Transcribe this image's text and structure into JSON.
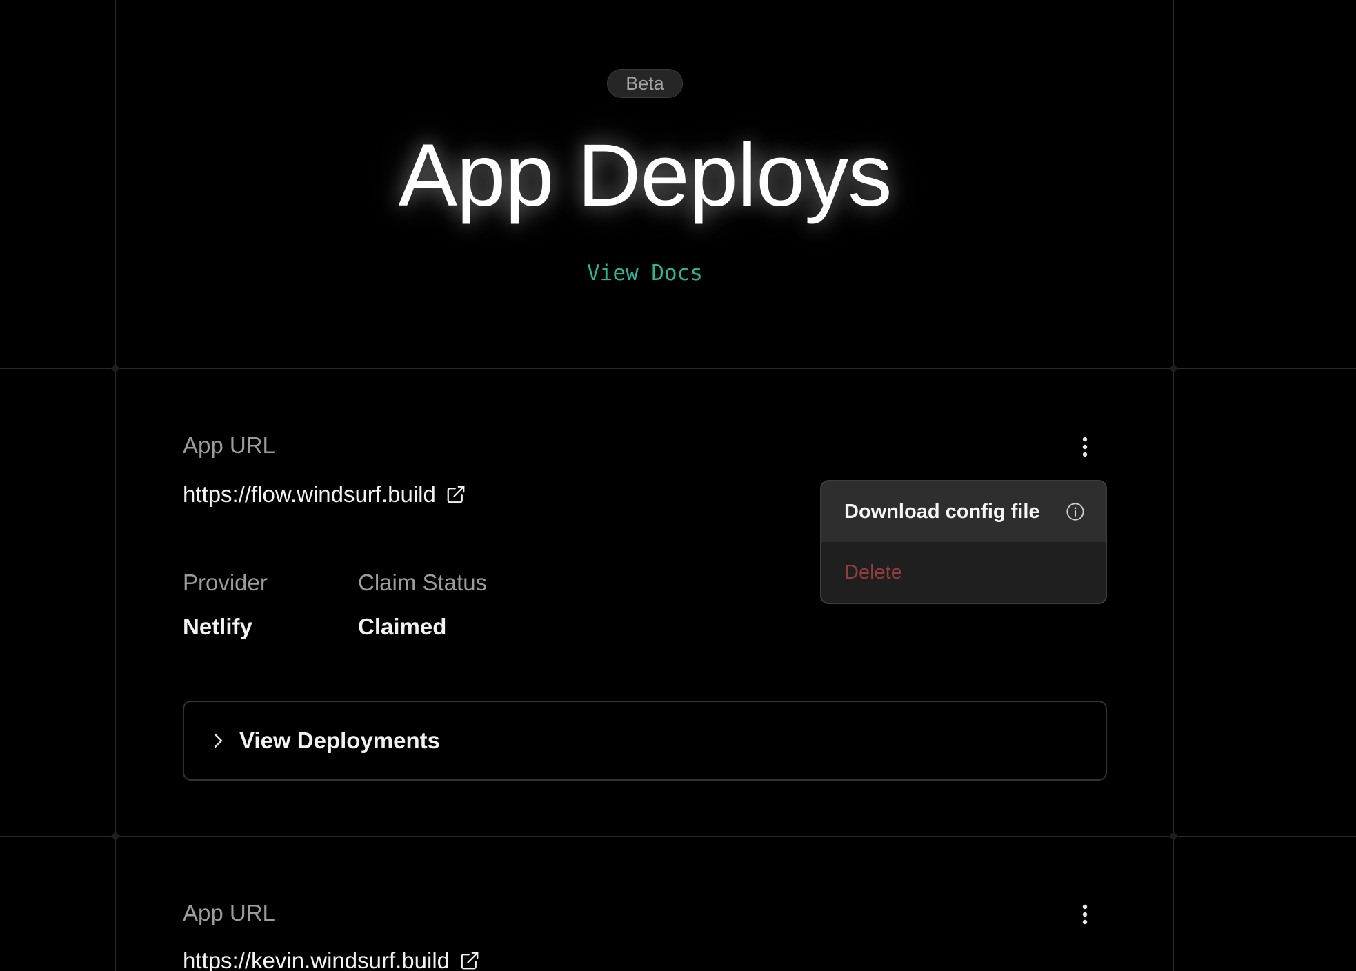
{
  "hero": {
    "badge": "Beta",
    "title": "App Deploys",
    "docs_link": "View Docs"
  },
  "deploys": [
    {
      "url_label": "App URL",
      "url": "https://flow.windsurf.build",
      "provider_label": "Provider",
      "provider": "Netlify",
      "claim_label": "Claim Status",
      "claim": "Claimed",
      "deployments_toggle": "View Deployments"
    },
    {
      "url_label": "App URL",
      "url": "https://kevin.windsurf.build"
    }
  ],
  "menu": {
    "download": "Download config file",
    "delete": "Delete"
  },
  "colors": {
    "background": "#000000",
    "accent": "#2bb596",
    "danger": "#8f3d3d",
    "grid": "#2a2a2a"
  },
  "icons": {
    "external": "external-link-icon",
    "more": "more-vertical-icon",
    "info": "info-icon",
    "chevron": "chevron-right-icon"
  }
}
